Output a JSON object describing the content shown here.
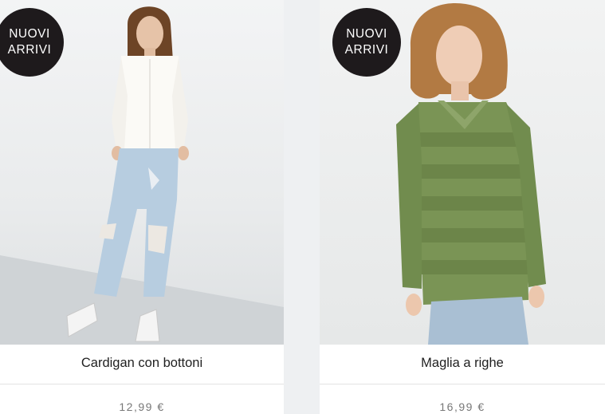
{
  "products": [
    {
      "badge": {
        "line1": "NUOVI",
        "line2": "ARRIVI"
      },
      "name": "Cardigan con bottoni",
      "price": "12,99 €",
      "image": "woman-white-cardigan-ripped-jeans"
    },
    {
      "badge": {
        "line1": "NUOVI",
        "line2": "ARRIVI"
      },
      "name": "Maglia a righe",
      "price": "16,99 €",
      "image": "woman-green-striped-sweater"
    }
  ],
  "colors": {
    "badge_bg": "#1e1a1c",
    "badge_text": "#ffffff",
    "name_text": "#1f1f1f",
    "price_text": "#777777"
  }
}
